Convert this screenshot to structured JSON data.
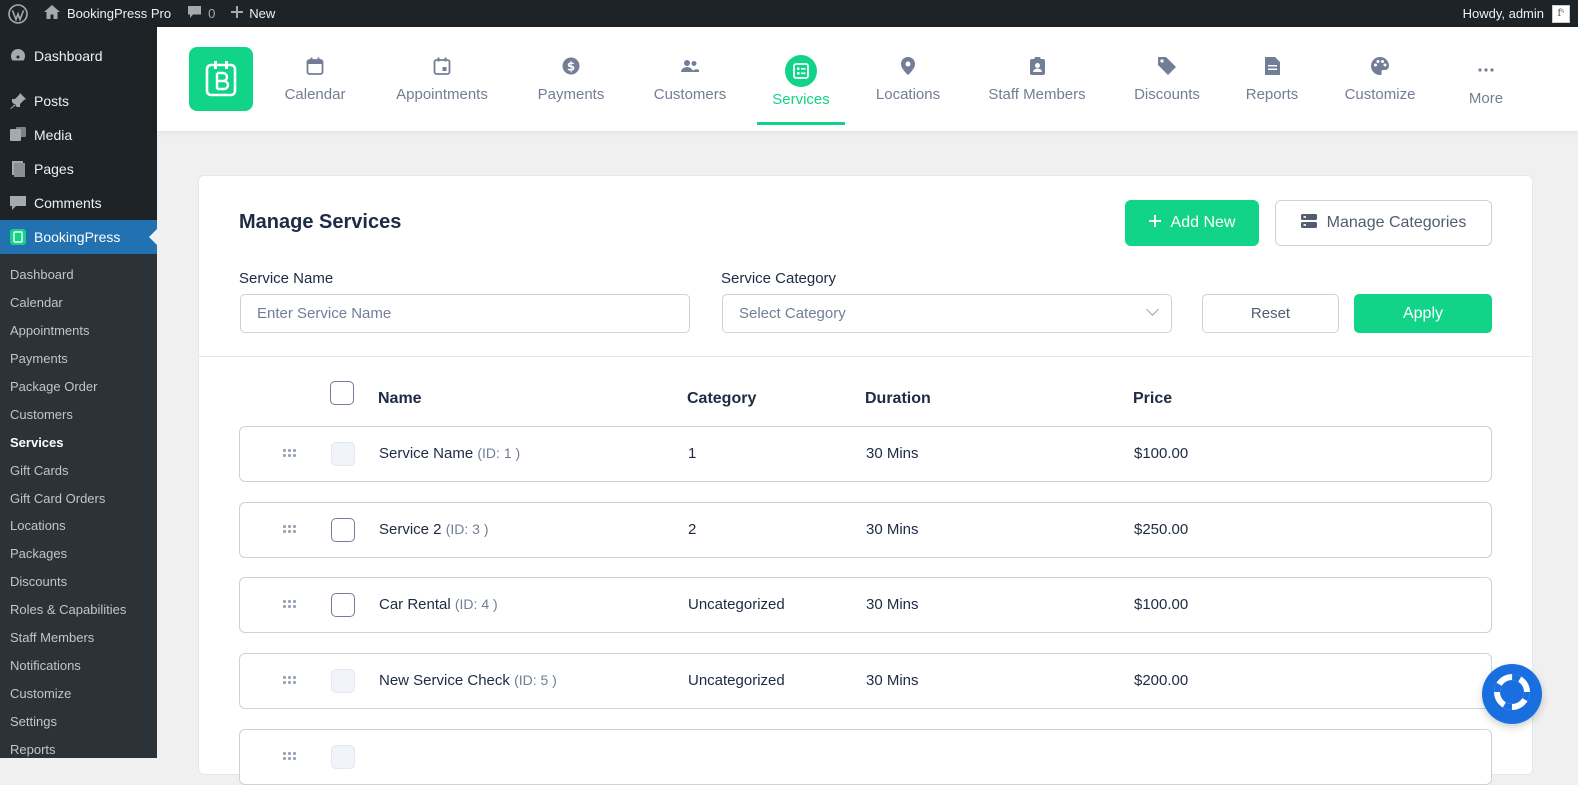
{
  "adminbar": {
    "site_name": "BookingPress Pro",
    "comments_count": "0",
    "new_label": "New",
    "howdy": "Howdy, admin",
    "avatar_letters": "fˢ"
  },
  "wp_menu": {
    "top_items": [
      {
        "label": "Dashboard",
        "icon": "dashboard-icon"
      },
      {
        "label": "Posts",
        "icon": "pin-icon"
      },
      {
        "label": "Media",
        "icon": "media-icon"
      },
      {
        "label": "Pages",
        "icon": "pages-icon"
      },
      {
        "label": "Comments",
        "icon": "comment-icon"
      },
      {
        "label": "BookingPress",
        "icon": "bookingpress-icon"
      }
    ],
    "sub_items": [
      "Dashboard",
      "Calendar",
      "Appointments",
      "Payments",
      "Package Order",
      "Customers",
      "Services",
      "Gift Cards",
      "Gift Card Orders",
      "Locations",
      "Packages",
      "Discounts",
      "Roles & Capabilities",
      "Staff Members",
      "Notifications",
      "Customize",
      "Settings",
      "Reports"
    ],
    "current_sub": "Services"
  },
  "nav": {
    "items": [
      {
        "label": "Calendar",
        "icon": "calendar-icon"
      },
      {
        "label": "Appointments",
        "icon": "appointments-icon"
      },
      {
        "label": "Payments",
        "icon": "dollar-icon"
      },
      {
        "label": "Customers",
        "icon": "users-icon"
      },
      {
        "label": "Services",
        "icon": "services-icon"
      },
      {
        "label": "Locations",
        "icon": "location-pin-icon"
      },
      {
        "label": "Staff Members",
        "icon": "clipboard-user-icon"
      },
      {
        "label": "Discounts",
        "icon": "tag-icon"
      },
      {
        "label": "Reports",
        "icon": "report-icon"
      },
      {
        "label": "Customize",
        "icon": "palette-icon"
      },
      {
        "label": "More",
        "icon": "more-dots-icon"
      }
    ],
    "active": "Services"
  },
  "page": {
    "title": "Manage Services",
    "add_new": "Add New",
    "manage_categories": "Manage Categories"
  },
  "filters": {
    "service_name_label": "Service Name",
    "service_name_placeholder": "Enter Service Name",
    "service_category_label": "Service Category",
    "service_category_placeholder": "Select Category",
    "reset": "Reset",
    "apply": "Apply"
  },
  "table": {
    "columns": [
      "Name",
      "Category",
      "Duration",
      "Price"
    ],
    "rows": [
      {
        "name": "Service Name",
        "id": "(ID: 1 )",
        "category": "1",
        "duration": "30 Mins",
        "price": "$100.00",
        "checkbox": "disabled"
      },
      {
        "name": "Service 2",
        "id": "(ID: 3 )",
        "category": "2",
        "duration": "30 Mins",
        "price": "$250.00",
        "checkbox": "enabled"
      },
      {
        "name": "Car Rental",
        "id": "(ID: 4 )",
        "category": "Uncategorized",
        "duration": "30 Mins",
        "price": "$100.00",
        "checkbox": "enabled"
      },
      {
        "name": "New Service Check",
        "id": "(ID: 5 )",
        "category": "Uncategorized",
        "duration": "30 Mins",
        "price": "$200.00",
        "checkbox": "disabled"
      },
      {
        "name": "",
        "id": "",
        "category": "",
        "duration": "",
        "price": "",
        "checkbox": "disabled"
      }
    ]
  },
  "colors": {
    "accent": "#12d488",
    "wp_dark": "#1d2327",
    "wp_highlight": "#2271b1",
    "help_button": "#1a6fe0"
  }
}
